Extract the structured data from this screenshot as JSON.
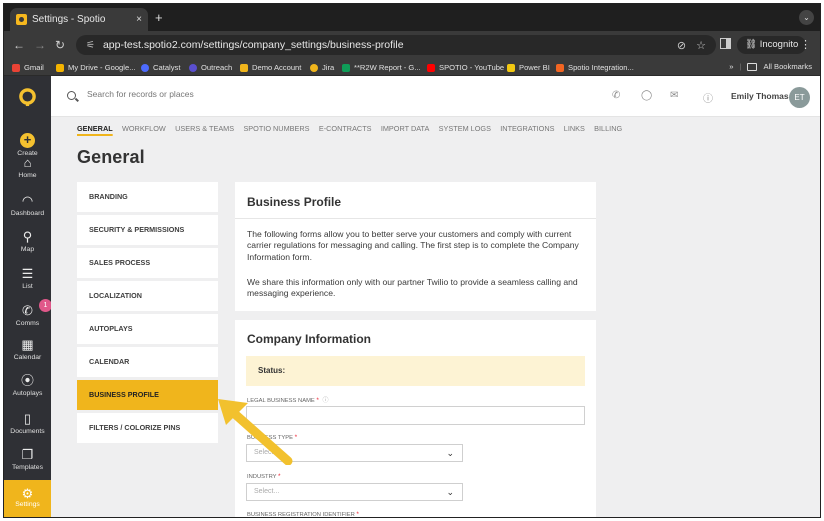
{
  "browser": {
    "tab_title": "Settings - Spotio",
    "tab_close": "×",
    "new_tab": "+",
    "url": "app-test.spotio2.com/settings/company_settings/business-profile",
    "incognito_label": "Incognito",
    "bookmarks": [
      {
        "label": "Gmail",
        "color": "#ea4335"
      },
      {
        "label": "My Drive - Google...",
        "color": "#f4b400"
      },
      {
        "label": "Catalyst",
        "color": "#4d6bfe"
      },
      {
        "label": "Outreach",
        "color": "#5a4fcf"
      },
      {
        "label": "Demo Account",
        "color": "#f0b51c"
      },
      {
        "label": "Jira",
        "color": "#f0b51c"
      },
      {
        "label": "**R2W Report - G...",
        "color": "#0f9d58"
      },
      {
        "label": "SPOTIO - YouTube",
        "color": "#ff0000"
      },
      {
        "label": "Power BI",
        "color": "#f2c811"
      },
      {
        "label": "Spotio Integration...",
        "color": "#f26522"
      }
    ],
    "bookmarks_overflow": "»",
    "all_bookmarks": "All Bookmarks"
  },
  "nav": {
    "items": [
      {
        "label": "Create",
        "icon": "plus-icon"
      },
      {
        "label": "Home",
        "icon": "home-icon"
      },
      {
        "label": "Dashboard",
        "icon": "gauge-icon"
      },
      {
        "label": "Map",
        "icon": "map-pin-icon"
      },
      {
        "label": "List",
        "icon": "list-icon"
      },
      {
        "label": "Comms",
        "icon": "phone-icon",
        "badge": "1"
      },
      {
        "label": "Calendar",
        "icon": "calendar-icon"
      },
      {
        "label": "Autoplays",
        "icon": "autoplay-icon"
      },
      {
        "label": "Documents",
        "icon": "document-icon"
      },
      {
        "label": "Templates",
        "icon": "templates-icon"
      }
    ],
    "active": {
      "label": "Settings",
      "icon": "gear-icon"
    }
  },
  "header": {
    "search_placeholder": "Search for records or places",
    "user_name": "Emily Thomas",
    "user_initials": "ET"
  },
  "settings_tabs": [
    "GENERAL",
    "WORKFLOW",
    "USERS & TEAMS",
    "SPOTIO NUMBERS",
    "E-CONTRACTS",
    "IMPORT DATA",
    "SYSTEM LOGS",
    "INTEGRATIONS",
    "LINKS",
    "BILLING"
  ],
  "page_title": "General",
  "menu": [
    "BRANDING",
    "SECURITY & PERMISSIONS",
    "SALES PROCESS",
    "LOCALIZATION",
    "AUTOPLAYS",
    "CALENDAR",
    "BUSINESS PROFILE",
    "FILTERS / COLORIZE PINS"
  ],
  "business_profile": {
    "title": "Business Profile",
    "paragraph1": "The following forms allow you to better serve your customers and comply with current carrier regulations for messaging and calling. The first step is to complete the Company Information form.",
    "paragraph2": "We share this information only with our partner Twilio to provide a seamless calling and messaging experience."
  },
  "company_info": {
    "title": "Company Information",
    "status_label": "Status:",
    "legal_name_label": "LEGAL BUSINESS NAME",
    "business_type_label": "BUSINESS TYPE",
    "industry_label": "INDUSTRY",
    "reg_id_label": "BUSINESS REGISTRATION IDENTIFIER",
    "required_mark": "*",
    "select_placeholder": "Select..."
  },
  "accent_color": "#f0b51c"
}
